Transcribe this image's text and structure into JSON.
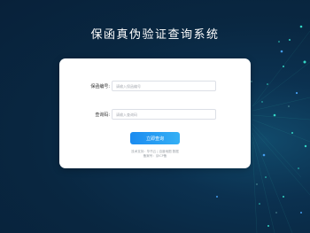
{
  "page": {
    "title": "保函真伪验证查询系统"
  },
  "form": {
    "guarantee_no_label": "保函编号:",
    "guarantee_no_placeholder": "请输入保函编号",
    "query_code_label": "查询码:",
    "query_code_placeholder": "请输入查询码",
    "submit_label": "立即查询"
  },
  "footer": {
    "line1": "技术支持：华书云 | 百度地图 数据",
    "line2": "备案号：京ICP备"
  },
  "colors": {
    "background": "#092741",
    "accent": "#1b8bf0",
    "card": "#ffffff"
  }
}
